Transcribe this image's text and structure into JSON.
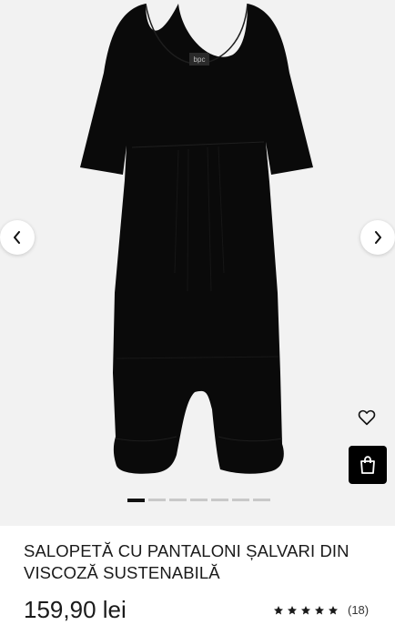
{
  "product": {
    "title": "SALOPETĂ CU PANTALONI ȘALVARI DIN VISCOZĂ SUSTENABILĂ",
    "price": "159,90 lei",
    "rating": {
      "stars": 5,
      "review_count": "(18)"
    }
  },
  "gallery": {
    "total_images": 7,
    "active_index": 0,
    "background_color": "#f2f2f2",
    "garment_color": "#0a0a0a",
    "logo_text": "bpc"
  },
  "icons": {
    "prev": "chevron-left-icon",
    "next": "chevron-right-icon",
    "wishlist": "heart-outline-icon",
    "cart": "shopping-bag-icon",
    "star": "star-filled-icon"
  },
  "colors": {
    "cart_button": "#000000",
    "text": "#1a1a1a"
  }
}
